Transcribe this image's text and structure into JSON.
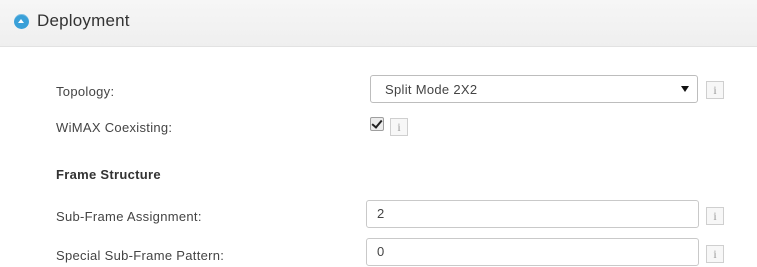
{
  "section": {
    "title": "Deployment",
    "collapse_icon": "chevron-up-circle-icon"
  },
  "colors": {
    "accent": "#3aa0d8",
    "header_bg": "#f2f2f2"
  },
  "fields": {
    "topology": {
      "label": "Topology:",
      "selected": "Split Mode 2X2",
      "info": "i"
    },
    "wimax": {
      "label": "WiMAX Coexisting:",
      "checked": true,
      "info": "i"
    },
    "frame_structure_heading": "Frame Structure",
    "subframe_assignment": {
      "label": "Sub-Frame Assignment:",
      "value": "2",
      "info": "i"
    },
    "special_subframe_pattern": {
      "label": "Special Sub-Frame Pattern:",
      "value": "0",
      "info": "i"
    }
  }
}
